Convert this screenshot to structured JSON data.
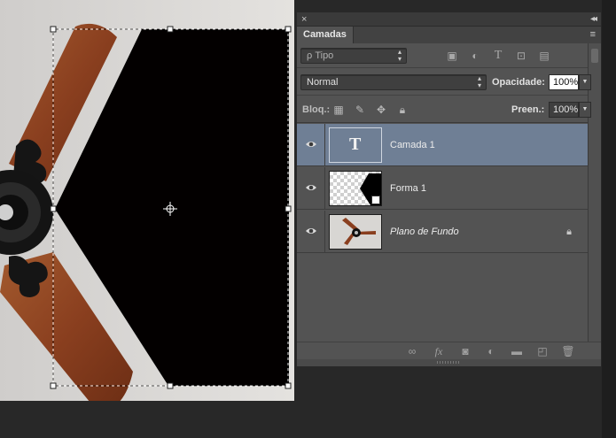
{
  "window": {
    "close_glyph": "×",
    "collapse_glyph": "◂◂"
  },
  "panel": {
    "tab_label": "Camadas",
    "menu_glyph": "≡"
  },
  "filter": {
    "kind_label": "ρ Tipo",
    "icons": [
      "image-filter-icon",
      "adjustment-filter-icon",
      "type-filter-icon",
      "shape-filter-icon",
      "smart-object-filter-icon"
    ]
  },
  "blend": {
    "mode": "Normal",
    "opacity_label": "Opacidade:",
    "opacity_value": "100%"
  },
  "lock": {
    "label": "Bloq.:",
    "fill_label": "Preen.:",
    "fill_value": "100%"
  },
  "layers": [
    {
      "name": "Camada 1",
      "italic": false,
      "selected": true,
      "thumb_icon": "T"
    },
    {
      "name": "Forma 1",
      "italic": false,
      "selected": false
    },
    {
      "name": "Plano de Fundo",
      "italic": true,
      "selected": false,
      "locked": true
    }
  ],
  "bottom_toolbar": {
    "fx_label": "fx",
    "icons": [
      "link-layers-icon",
      "fx-icon",
      "layer-mask-icon",
      "adjustment-layer-icon",
      "group-folder-icon",
      "new-layer-icon",
      "trash-icon"
    ]
  },
  "colors": {
    "selected_row": "#6f7f95",
    "panel_bg": "#535353",
    "canvas_shape": "#030000",
    "blade_wood": "#8a3f1f"
  }
}
